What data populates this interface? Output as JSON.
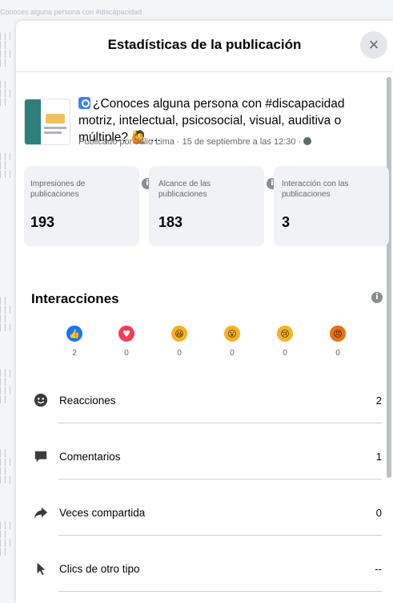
{
  "background": {
    "top_line": "Conoces alguna persona con #discapacidad"
  },
  "modal": {
    "title": "Estadísticas de la publicación",
    "close_label": "×"
  },
  "post": {
    "text": "¿Conoces alguna persona con #discapacidad motriz, intelectual, psicosocial, visual, auditiva o múltiple? 🙋 ...",
    "meta": "Publicado por Julio Lima · 15 de septiembre a las 12:30 ·"
  },
  "stats": [
    {
      "label": "Impresiones de publicaciones",
      "value": "193"
    },
    {
      "label": "Alcance de las publicaciones",
      "value": "183"
    },
    {
      "label": "Interacción con las publicaciones",
      "value": "3"
    }
  ],
  "interactions": {
    "title": "Interacciones",
    "reactions": [
      {
        "name": "like",
        "count": "2",
        "color": "#1877f2"
      },
      {
        "name": "love",
        "count": "0",
        "color": "#f33e58"
      },
      {
        "name": "haha",
        "count": "0",
        "color": "#f7b125"
      },
      {
        "name": "wow",
        "count": "0",
        "color": "#f7b125"
      },
      {
        "name": "sad",
        "count": "0",
        "color": "#f7b125"
      },
      {
        "name": "angry",
        "count": "0",
        "color": "#e9710f"
      }
    ],
    "rows": [
      {
        "label": "Reacciones",
        "value": "2",
        "icon": "smiley-icon"
      },
      {
        "label": "Comentarios",
        "value": "1",
        "icon": "comment-icon"
      },
      {
        "label": "Veces compartida",
        "value": "0",
        "icon": "share-icon"
      },
      {
        "label": "Clics de otro tipo",
        "value": "--",
        "icon": "cursor-icon"
      }
    ]
  }
}
